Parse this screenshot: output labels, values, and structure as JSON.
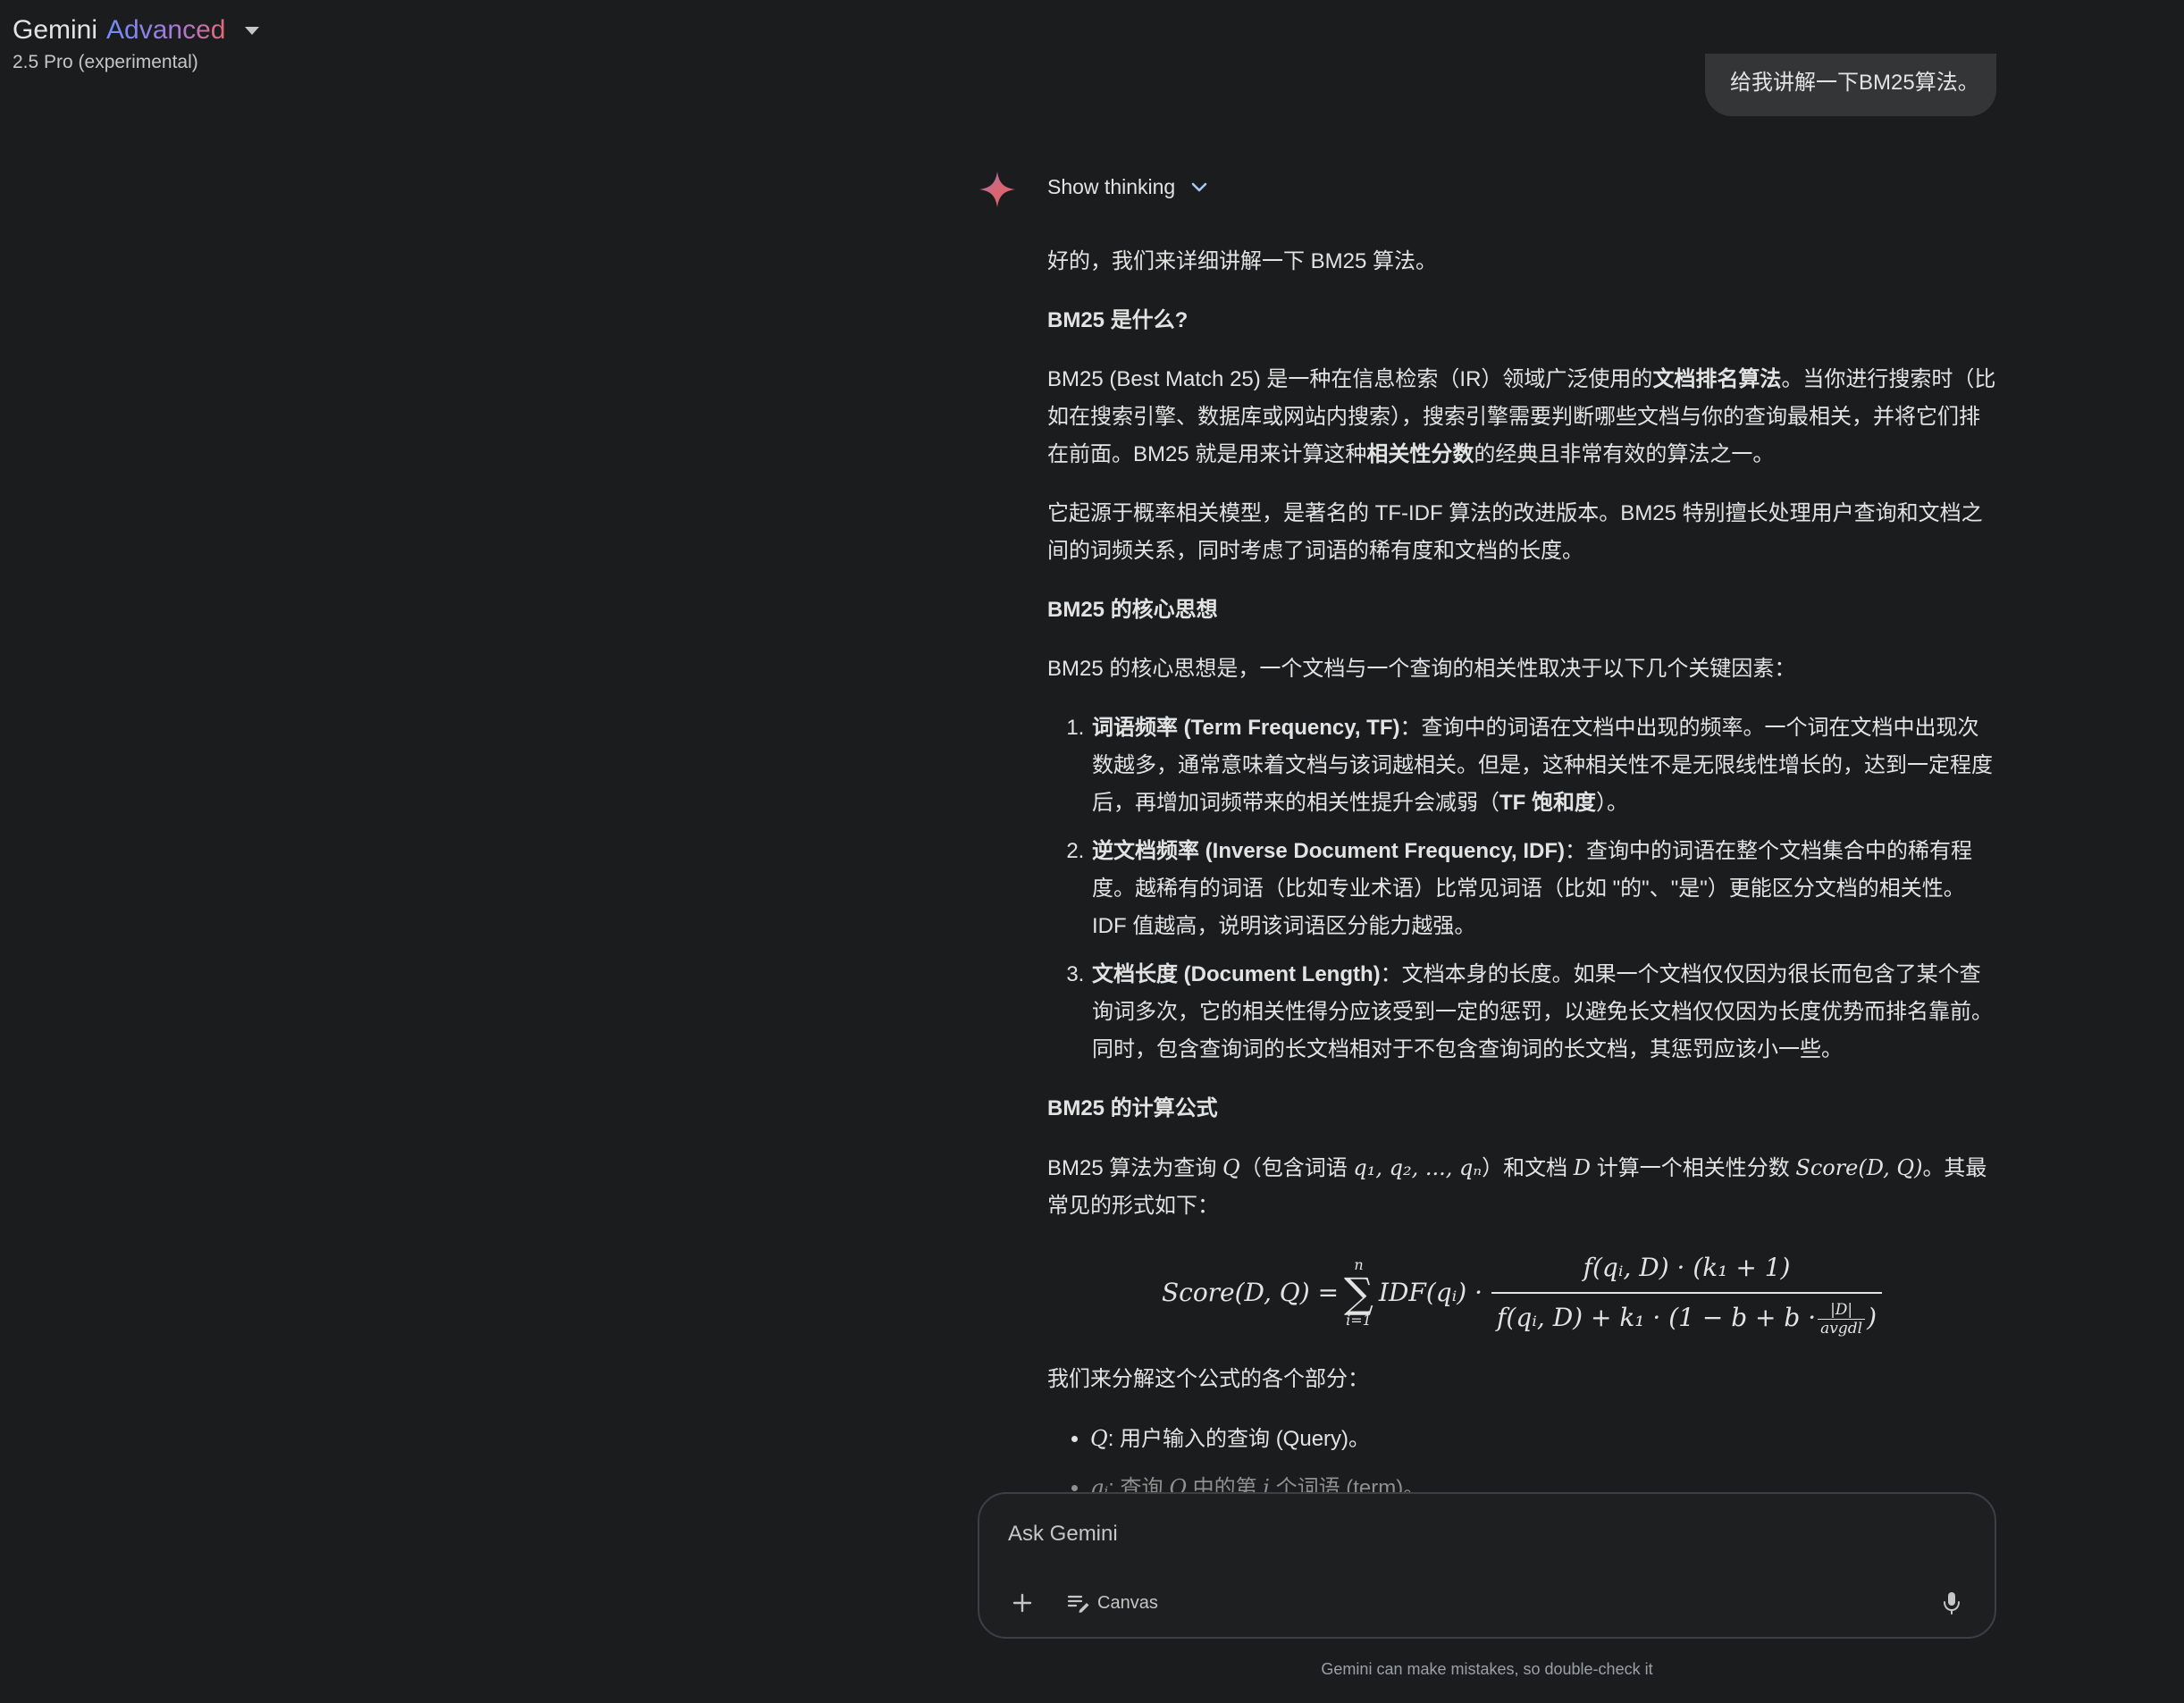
{
  "header": {
    "brand": "Gemini",
    "tier": "Advanced",
    "model": "2.5 Pro (experimental)"
  },
  "user_message": "给我讲解一下BM25算法。",
  "thinking_label": "Show thinking",
  "response": {
    "intro": "好的，我们来详细讲解一下 BM25 算法。",
    "h1": "BM25 是什么?",
    "p1a": "BM25 (Best Match 25) 是一种在信息检索（IR）领域广泛使用的",
    "p1b": "文档排名算法",
    "p1c": "。当你进行搜索时（比如在搜索引擎、数据库或网站内搜索），搜索引擎需要判断哪些文档与你的查询最相关，并将它们排在前面。BM25 就是用来计算这种",
    "p1d": "相关性分数",
    "p1e": "的经典且非常有效的算法之一。",
    "p2": "它起源于概率相关模型，是著名的 TF-IDF 算法的改进版本。BM25 特别擅长处理用户查询和文档之间的词频关系，同时考虑了词语的稀有度和文档的长度。",
    "h2": "BM25 的核心思想",
    "p3": "BM25 的核心思想是，一个文档与一个查询的相关性取决于以下几个关键因素：",
    "li1a": "词语频率 (Term Frequency, TF)",
    "li1b": "：查询中的词语在文档中出现的频率。一个词在文档中出现次数越多，通常意味着文档与该词越相关。但是，这种相关性不是无限线性增长的，达到一定程度后，再增加词频带来的相关性提升会减弱（",
    "li1c": "TF 饱和度",
    "li1d": "）。",
    "li2a": "逆文档频率 (Inverse Document Frequency, IDF)",
    "li2b": "：查询中的词语在整个文档集合中的稀有程度。越稀有的词语（比如专业术语）比常见词语（比如 \"的\"、\"是\"）更能区分文档的相关性。IDF 值越高，说明该词语区分能力越强。",
    "li3a": "文档长度 (Document Length)",
    "li3b": "：文档本身的长度。如果一个文档仅仅因为很长而包含了某个查询词多次，它的相关性得分应该受到一定的惩罚，以避免长文档仅仅因为长度优势而排名靠前。同时，包含查询词的长文档相对于不包含查询词的长文档，其惩罚应该小一些。",
    "h3": "BM25 的计算公式",
    "p4a": "BM25 算法为查询 ",
    "p4b": "（包含词语 ",
    "p4c": "）和文档 ",
    "p4d": " 计算一个相关性分数 ",
    "p4e": "。其最常见的形式如下：",
    "p5": "我们来分解这个公式的各个部分：",
    "b1": ": 用户输入的查询 (Query)。",
    "b2a": ": 查询 ",
    "b2b": " 中的第 ",
    "b2c": " 个词语 (term)。"
  },
  "math": {
    "Q": "Q",
    "D": "D",
    "i": "i",
    "terms": "q₁, q₂, ..., qₙ",
    "score": "Score(D, Q)",
    "qi": "qᵢ",
    "f_lhs": "Score(D, Q) =",
    "f_upper": "n",
    "f_sigma": "∑",
    "f_lower": "i=1",
    "f_idf": "IDF(qᵢ) ·",
    "f_num": "f(qᵢ, D) · (k₁ + 1)",
    "f_den1": "f(qᵢ, D) + k₁ · (1 − b + b ·",
    "f_den_num": "|D|",
    "f_den_den": "avgdl",
    "f_den2": ")"
  },
  "input": {
    "placeholder": "Ask Gemini",
    "canvas_label": "Canvas"
  },
  "disclaimer": "Gemini can make mistakes, so double-check it",
  "icons": {
    "spark": "gemini-spark-icon",
    "chevron": "chevron-down-icon",
    "plus": "plus-icon",
    "canvas": "canvas-icon",
    "mic": "mic-icon"
  },
  "colors": {
    "background": "#1b1c1d",
    "text": "#e3e3e3",
    "spark": "#d96570",
    "muted": "#c4c7c5"
  }
}
